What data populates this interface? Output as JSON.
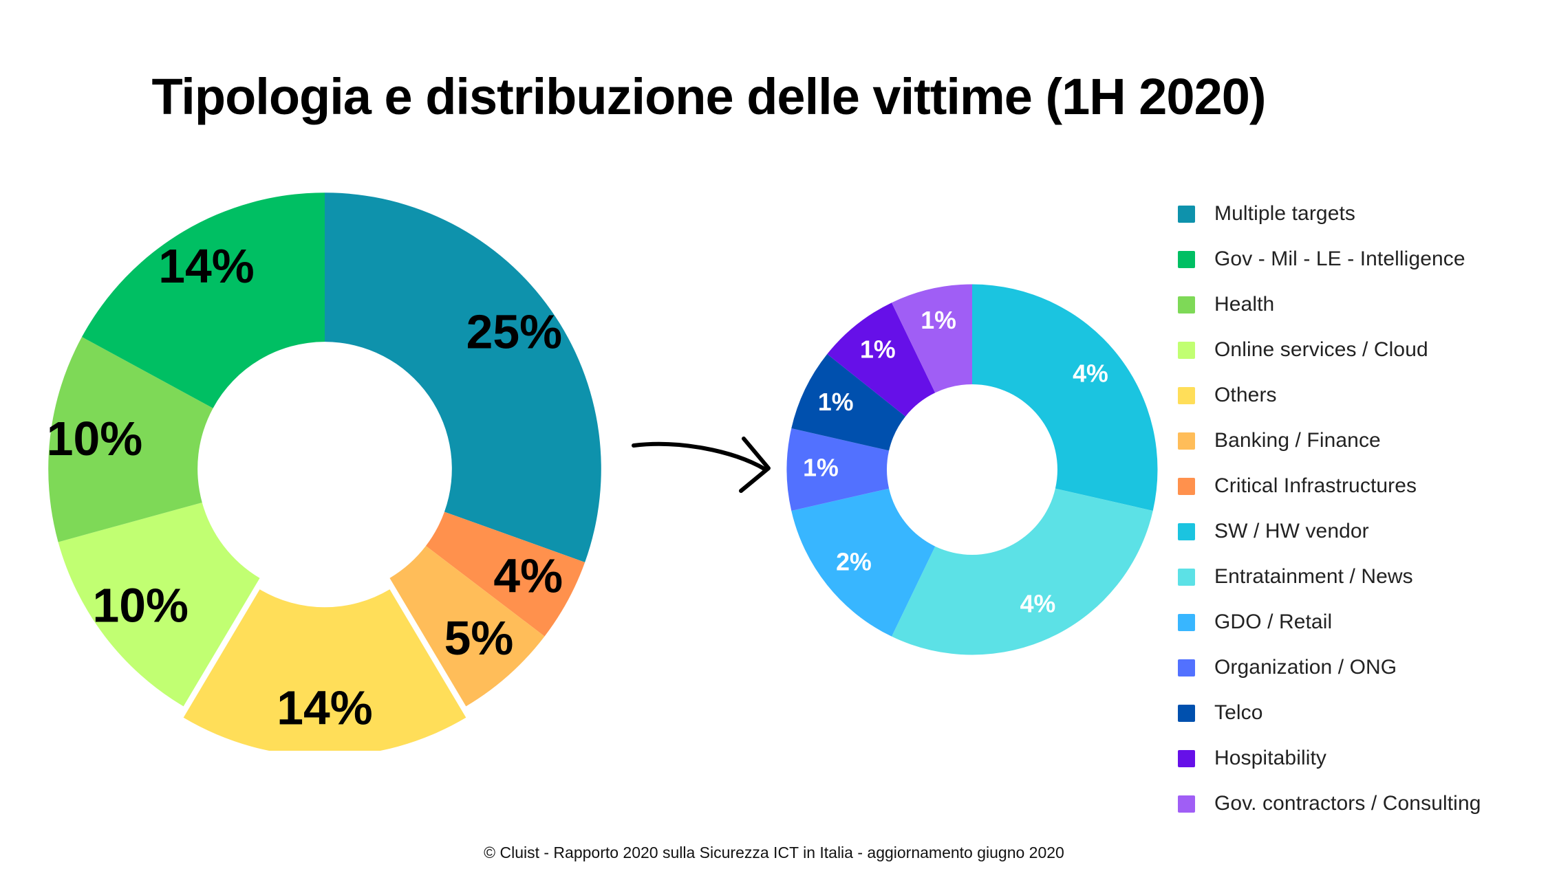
{
  "title": "Tipologia e distribuzione delle vittime (1H 2020)",
  "footer": "© Cluist - Rapporto 2020 sulla Sicurezza ICT in Italia - aggiornamento giugno 2020",
  "legend": {
    "items": [
      {
        "label": "Multiple targets",
        "color": "#0e92ac"
      },
      {
        "label": "Gov - Mil - LE - Intelligence",
        "color": "#00bf63"
      },
      {
        "label": "Health",
        "color": "#7ed957"
      },
      {
        "label": "Online services / Cloud",
        "color": "#c1ff72"
      },
      {
        "label": "Others",
        "color": "#ffde59"
      },
      {
        "label": "Banking / Finance",
        "color": "#ffbd59"
      },
      {
        "label": "Critical Infrastructures",
        "color": "#ff914d"
      },
      {
        "label": "SW / HW vendor",
        "color": "#1bc4e0"
      },
      {
        "label": "Entratainment / News",
        "color": "#5ce1e6"
      },
      {
        "label": "GDO / Retail",
        "color": "#38b6ff"
      },
      {
        "label": "Organization / ONG",
        "color": "#5271ff"
      },
      {
        "label": "Telco",
        "color": "#0050ae"
      },
      {
        "label": "Hospitability",
        "color": "#6610e8"
      },
      {
        "label": "Gov. contractors / Consulting",
        "color": "#a05ef5"
      }
    ]
  },
  "chart_data": [
    {
      "type": "pie",
      "name": "main-donut",
      "title": "Tipologia e distribuzione delle vittime (1H 2020)",
      "unit": "%",
      "hole": 0.46,
      "start_angle_deg": -90,
      "legend_position": "right",
      "categories": [
        "Multiple targets",
        "Critical Infrastructures",
        "Banking / Finance",
        "Others",
        "Online services / Cloud",
        "Health",
        "Gov - Mil - LE - Intelligence"
      ],
      "values": [
        25,
        4,
        5,
        14,
        10,
        10,
        14
      ],
      "labels": [
        "25%",
        "4%",
        "5%",
        "14%",
        "10%",
        "10%",
        "14%"
      ],
      "colors": [
        "#0e92ac",
        "#ff914d",
        "#ffbd59",
        "#ffde59",
        "#c1ff72",
        "#7ed957",
        "#00bf63"
      ],
      "exploded": [
        "Others"
      ]
    },
    {
      "type": "pie",
      "name": "sub-donut",
      "title": "Breakdown of Others",
      "unit": "%",
      "hole": 0.46,
      "start_angle_deg": -90,
      "legend_position": "right",
      "categories": [
        "SW / HW vendor",
        "Entratainment / News",
        "GDO / Retail",
        "Organization / ONG",
        "Telco",
        "Hospitability",
        "Gov. contractors / Consulting"
      ],
      "values": [
        4,
        4,
        2,
        1,
        1,
        1,
        1
      ],
      "labels": [
        "4%",
        "4%",
        "2%",
        "1%",
        "1%",
        "1%",
        "1%"
      ],
      "colors": [
        "#1bc4e0",
        "#5ce1e6",
        "#38b6ff",
        "#5271ff",
        "#0050ae",
        "#6610e8",
        "#a05ef5"
      ]
    }
  ]
}
